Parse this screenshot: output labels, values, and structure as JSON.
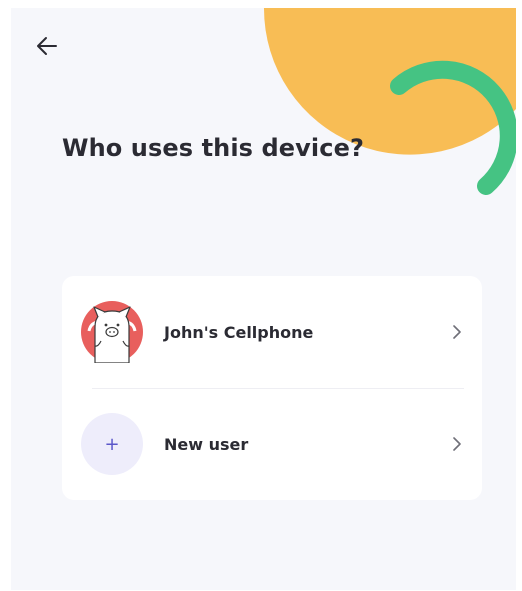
{
  "header": {
    "back_icon": "arrow-left-icon",
    "title": "Who uses this device?"
  },
  "users": [
    {
      "name": "John's Cellphone",
      "avatar_icon": "pig-avatar-icon",
      "trailing_icon": "chevron-right-icon"
    },
    {
      "name": "New user",
      "avatar_icon": "plus-icon",
      "avatar_glyph": "+",
      "trailing_icon": "chevron-right-icon"
    }
  ],
  "colors": {
    "background": "#f6f7fb",
    "decor_orange": "#f8bd55",
    "decor_green": "#45c383",
    "text": "#2b2b33",
    "accent": "#5b57c9",
    "avatar_red": "#e85f5d"
  }
}
